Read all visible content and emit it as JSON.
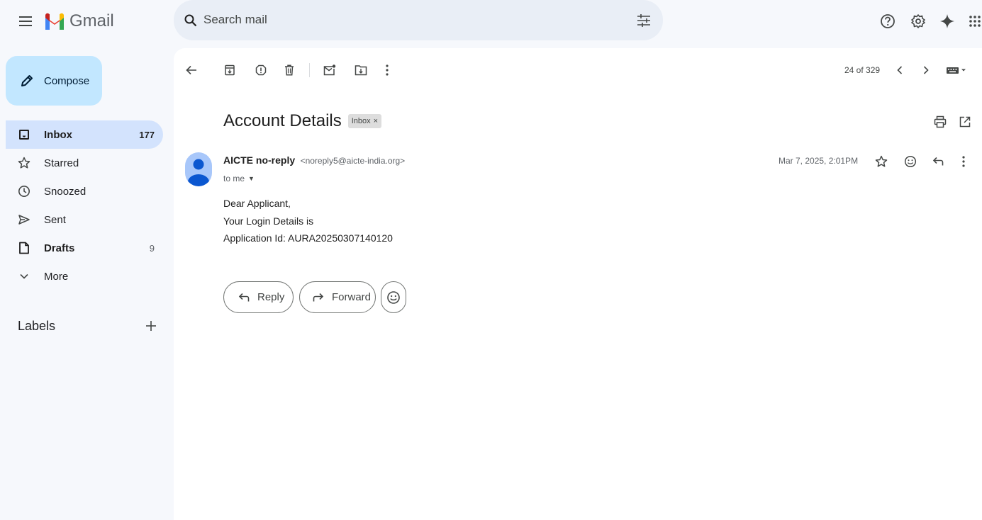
{
  "app": {
    "logo_text": "Gmail"
  },
  "search": {
    "placeholder": "Search mail"
  },
  "sidebar": {
    "compose_label": "Compose",
    "items": [
      {
        "label": "Inbox",
        "count": "177",
        "icon": "inbox-icon"
      },
      {
        "label": "Starred",
        "count": "",
        "icon": "star-icon"
      },
      {
        "label": "Snoozed",
        "count": "",
        "icon": "clock-icon"
      },
      {
        "label": "Sent",
        "count": "",
        "icon": "send-icon"
      },
      {
        "label": "Drafts",
        "count": "9",
        "icon": "file-icon"
      },
      {
        "label": "More",
        "count": "",
        "icon": "chevron-down-icon"
      }
    ],
    "labels_title": "Labels"
  },
  "toolbar": {
    "pager_text": "24 of 329"
  },
  "message": {
    "subject": "Account Details",
    "label_chip": "Inbox",
    "label_chip_close": "×",
    "sender_name": "AICTE no-reply",
    "sender_email": "<noreply5@aicte-india.org>",
    "to": "to me",
    "date": "Mar 7, 2025, 2:01PM",
    "body": [
      "Dear Applicant,",
      "Your Login Details is",
      "Application Id: AURA20250307140120"
    ]
  },
  "actions": {
    "reply_label": "Reply",
    "forward_label": "Forward"
  },
  "colors": {
    "background": "#f6f8fc",
    "search_bg": "#e9eef6",
    "compose_bg": "#c2e7ff",
    "active_nav_bg": "#d3e3fd",
    "avatar_bg": "#a8c7fa",
    "avatar_fg": "#0b57d0"
  }
}
